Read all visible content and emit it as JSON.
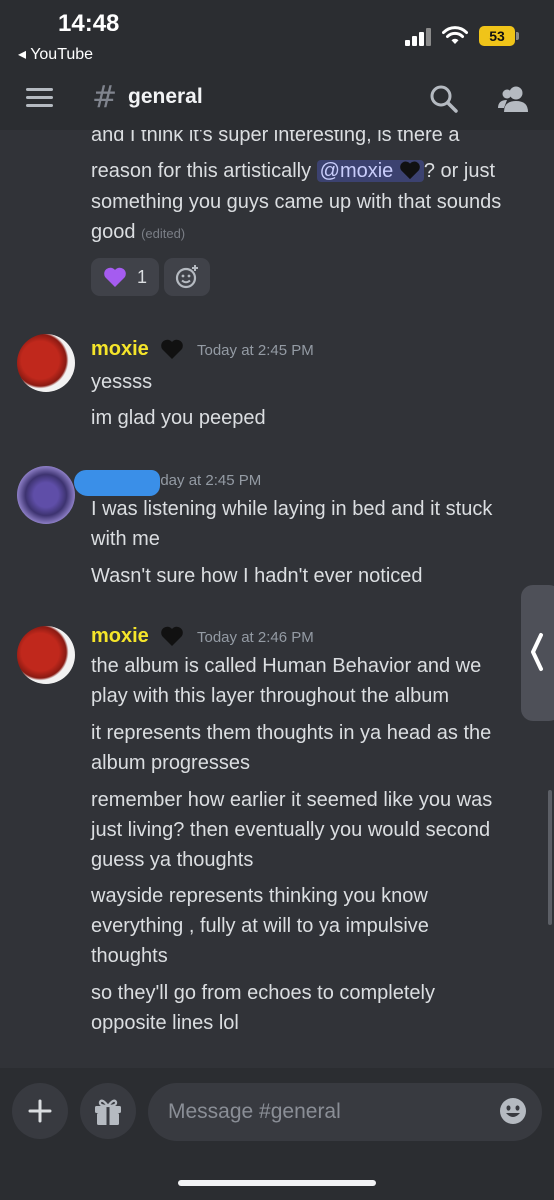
{
  "status_bar": {
    "time": "14:48",
    "back_app": "◂ YouTube",
    "battery": "53"
  },
  "header": {
    "channel_name": "general",
    "icons": [
      "menu-icon",
      "hash-icon",
      "search-icon",
      "members-icon"
    ]
  },
  "messages": {
    "partial_message": {
      "line1": "and I think it's super interesting, is there a",
      "line2_pre": "reason for this artistically ",
      "mention": "@moxie",
      "line2_post": "? or just",
      "line3": "something you guys came up with that sounds",
      "line4": "good",
      "edited": "(edited)",
      "reaction": {
        "emoji": "purple-heart",
        "count": "1"
      }
    },
    "group1": {
      "username": "moxie",
      "timestamp": "Today at 2:45 PM",
      "lines": [
        "yessss",
        "im glad you peeped"
      ]
    },
    "group2": {
      "timestamp": "Today at 2:45 PM",
      "timestamp_visible": "oday at 2:45 PM",
      "lines": [
        "I was listening while laying in bed and it stuck",
        "with me",
        "Wasn't sure how I hadn't ever noticed"
      ]
    },
    "group3": {
      "username": "moxie",
      "timestamp": "Today at 2:46 PM",
      "lines": [
        "the album is called Human Behavior and we",
        "play with this layer throughout the album",
        "it represents them thoughts in ya head as the",
        "album progresses",
        "remember how earlier it seemed like you was",
        "just living? then eventually you would second",
        "guess ya thoughts",
        "wayside represents thinking you know",
        "everything , fully at will to ya impulsive",
        "thoughts",
        "so they'll go from echoes to completely",
        "opposite lines lol"
      ]
    }
  },
  "composer": {
    "placeholder": "Message #general"
  },
  "colors": {
    "background": "#313338",
    "bars": "#2b2d31",
    "username": "#f5e52a",
    "mention_bg": "#3c4270",
    "battery": "#f0c419"
  }
}
